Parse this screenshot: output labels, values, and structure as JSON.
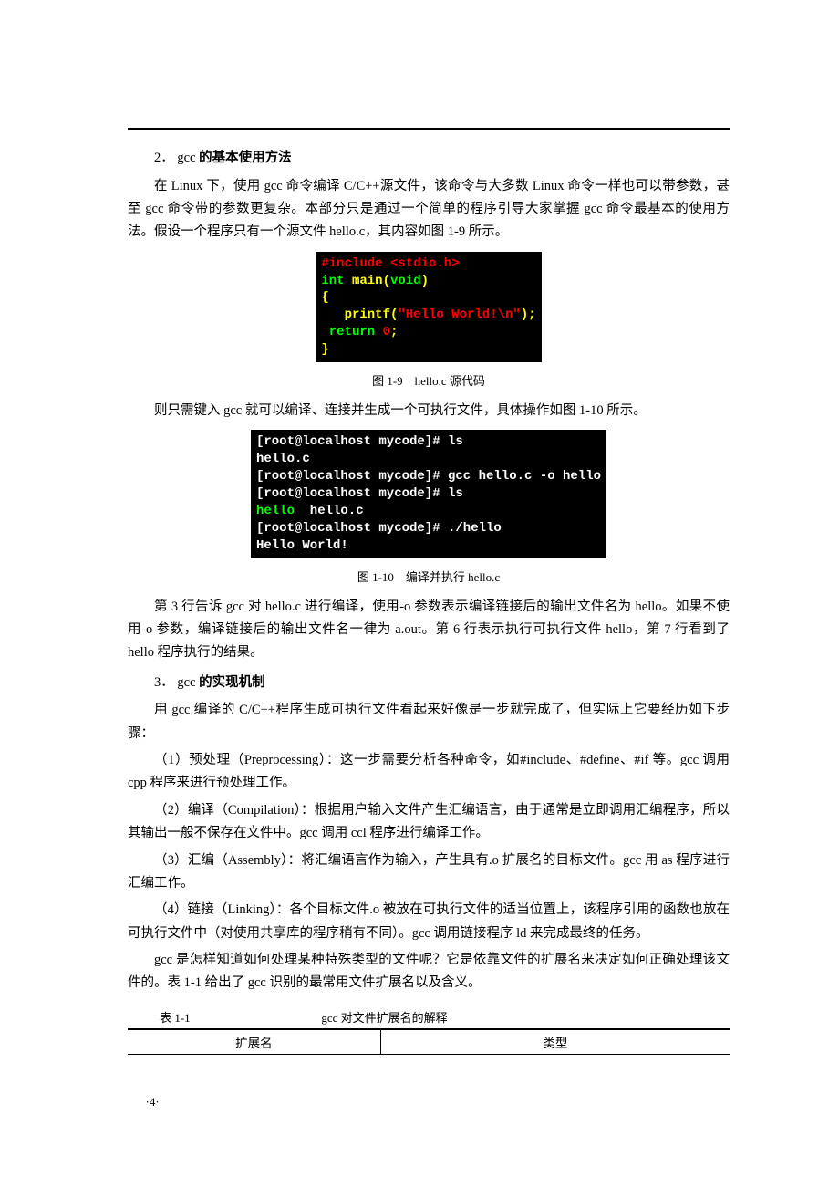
{
  "section1": {
    "num": "2．",
    "title_prefix": "gcc ",
    "title_bold": "的基本使用方法"
  },
  "p1": "在 Linux 下，使用 gcc 命令编译 C/C++源文件，该命令与大多数 Linux 命令一样也可以带参数，甚至 gcc 命令带的参数更复杂。本部分只是通过一个简单的程序引导大家掌握 gcc 命令最基本的使用方法。假设一个程序只有一个源文件 hello.c，其内容如图 1-9 所示。",
  "code1": {
    "l1a": "#include ",
    "l1b": "<stdio.h>",
    "l2a": "int ",
    "l2b": "main(",
    "l2c": "void",
    "l2d": ")",
    "l3": "{",
    "l4a": "   printf(",
    "l4b": "\"Hello World!",
    "l4c": "\\n",
    "l4d": "\"",
    "l4e": ");",
    "l5a": " ",
    "l5b": "return ",
    "l5c": "0",
    "l5d": ";",
    "l6": "}"
  },
  "cap1": "图 1-9　hello.c 源代码",
  "p2": "则只需键入 gcc 就可以编译、连接并生成一个可执行文件，具体操作如图 1-10 所示。",
  "code2": {
    "l1": "[root@localhost mycode]# ls",
    "l2": "hello.c",
    "l3": "[root@localhost mycode]# gcc hello.c -o hello",
    "l4": "[root@localhost mycode]# ls",
    "l5a": "hello",
    "l5b": "  hello.c",
    "l6": "[root@localhost mycode]# ./hello",
    "l7": "Hello World!"
  },
  "cap2": "图 1-10　编译并执行 hello.c",
  "p3": "第 3 行告诉 gcc 对 hello.c 进行编译，使用-o 参数表示编译链接后的输出文件名为 hello。如果不使用-o 参数，编译链接后的输出文件名一律为 a.out。第 6 行表示执行可执行文件 hello，第 7 行看到了 hello 程序执行的结果。",
  "section2": {
    "num": "3．",
    "title_prefix": "gcc ",
    "title_bold": "的实现机制"
  },
  "p4": "用 gcc 编译的 C/C++程序生成可执行文件看起来好像是一步就完成了，但实际上它要经历如下步骤：",
  "p5": "（1）预处理（Preprocessing）：这一步需要分析各种命令，如#include、#define、#if 等。gcc 调用 cpp 程序来进行预处理工作。",
  "p6": "（2）编译（Compilation）：根据用户输入文件产生汇编语言，由于通常是立即调用汇编程序，所以其输出一般不保存在文件中。gcc 调用 ccl 程序进行编译工作。",
  "p7": "（3）汇编（Assembly）：将汇编语言作为输入，产生具有.o 扩展名的目标文件。gcc 用 as 程序进行汇编工作。",
  "p8": "（4）链接（Linking）：各个目标文件.o 被放在可执行文件的适当位置上，该程序引用的函数也放在可执行文件中（对使用共享库的程序稍有不同）。gcc 调用链接程序 ld 来完成最终的任务。",
  "p9": "gcc 是怎样知道如何处理某种特殊类型的文件呢？它是依靠文件的扩展名来决定如何正确处理该文件的。表 1-1 给出了 gcc 识别的最常用文件扩展名以及含义。",
  "table": {
    "no": "表 1-1",
    "title": "gcc 对文件扩展名的解释",
    "h1": "扩展名",
    "h2": "类型"
  },
  "page_num": "·4·"
}
